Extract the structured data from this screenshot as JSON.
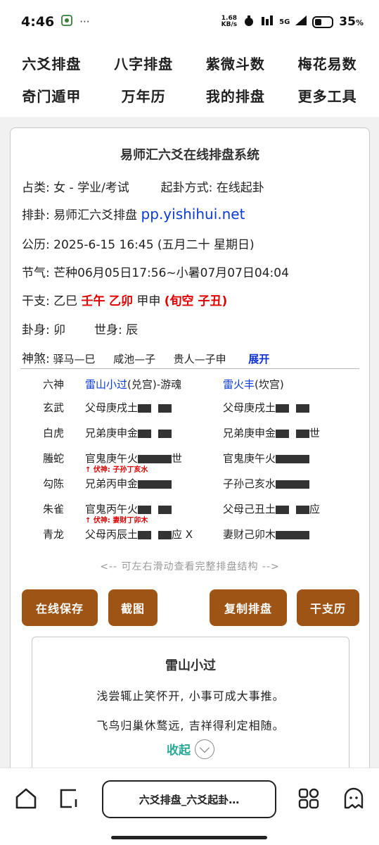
{
  "status": {
    "time": "4:46",
    "speed_top": "1.68",
    "speed_bottom": "KB/s",
    "net": "5G",
    "battery": "35",
    "battery_unit": "%"
  },
  "nav": [
    "六爻排盘",
    "八字排盘",
    "紫微斗数",
    "梅花易数",
    "奇门遁甲",
    "万年历",
    "我的排盘",
    "更多工具"
  ],
  "card": {
    "title": "易师汇六爻在线排盘系统",
    "zhanlei_label": "占类:",
    "zhanlei_value": "女 - 学业/考试",
    "qigua_label": "起卦方式:",
    "qigua_value": "在线起卦",
    "paigua_label": "排卦:",
    "paigua_value": "易师汇六爻排盘",
    "paigua_site": "pp.yishihui.net",
    "gongli_label": "公历:",
    "gongli_value": "2025-6-15 16:45 (五月二十 星期日)",
    "jieqi_label": "节气:",
    "jieqi_value": "芒种06月05日17:56~小暑07月07日04:04",
    "ganzhi_label": "干支:",
    "ganzhi_year": "乙巳",
    "ganzhi_month": "壬午",
    "ganzhi_day": "乙卯",
    "ganzhi_hour": "甲申",
    "xunkong": "(旬空 子丑)",
    "guashen_label": "卦身:",
    "guashen_value": "卯",
    "shishen_label": "世身:",
    "shishen_value": "辰",
    "shensha_label": "神煞:",
    "shensha_1": "驿马—巳",
    "shensha_2": "咸池—子",
    "shensha_3": "贵人—子申",
    "expand": "展开"
  },
  "hexagram": {
    "header_god": "六神",
    "main_name": "雷山小过",
    "main_palace": "(兑宫)-游魂",
    "changed_name": "雷火丰",
    "changed_palace": "(坎宫)",
    "rows": [
      {
        "god": "玄武",
        "left": "父母庚戌土",
        "left_line": "yin",
        "left_mark": "",
        "right": "父母庚戌土",
        "right_line": "yin",
        "right_mark": ""
      },
      {
        "god": "白虎",
        "left": "兄弟庚申金",
        "left_line": "yin",
        "left_mark": "",
        "right": "兄弟庚申金",
        "right_line": "yin",
        "right_mark": "世"
      },
      {
        "god": "螣蛇",
        "left": "官鬼庚午火",
        "left_line": "yang",
        "left_mark": "世",
        "right": "官鬼庚午火",
        "right_line": "yang",
        "right_mark": ""
      },
      {
        "god": "勾陈",
        "left": "兄弟丙申金",
        "left_line": "yang",
        "left_mark": "",
        "right": "子孙己亥水",
        "right_line": "yang",
        "right_mark": ""
      },
      {
        "god": "朱雀",
        "left": "官鬼丙午火",
        "left_line": "yin",
        "left_mark": "",
        "right": "父母己丑土",
        "right_line": "yin",
        "right_mark": "应"
      },
      {
        "god": "青龙",
        "left": "父母丙辰土",
        "left_line": "yin",
        "left_mark": "应 X",
        "right": "妻财己卯木",
        "right_line": "yang",
        "right_mark": ""
      }
    ],
    "fushen_1": "↑ 伏神: 子孙丁亥水",
    "fushen_2": "↑ 伏神: 妻财丁卯木"
  },
  "hint": "<-- 可左右滑动查看完整排盘结构 -->",
  "buttons": [
    "在线保存",
    "截图",
    "复制排盘",
    "干支历"
  ],
  "guaci": {
    "title": "雷山小过",
    "line1": "浅尝辄止笑怀开, 小事可成大事推。",
    "line2": "飞鸟归巢休鹜远, 吉祥得利定相随。",
    "collapse": "收起"
  },
  "browser": {
    "address": "六爻排盘_六爻起卦…"
  },
  "colors": {
    "button_brown": "#9d5415",
    "red": "#e00000",
    "blue": "#0b3bd6",
    "teal": "#2aa898"
  }
}
